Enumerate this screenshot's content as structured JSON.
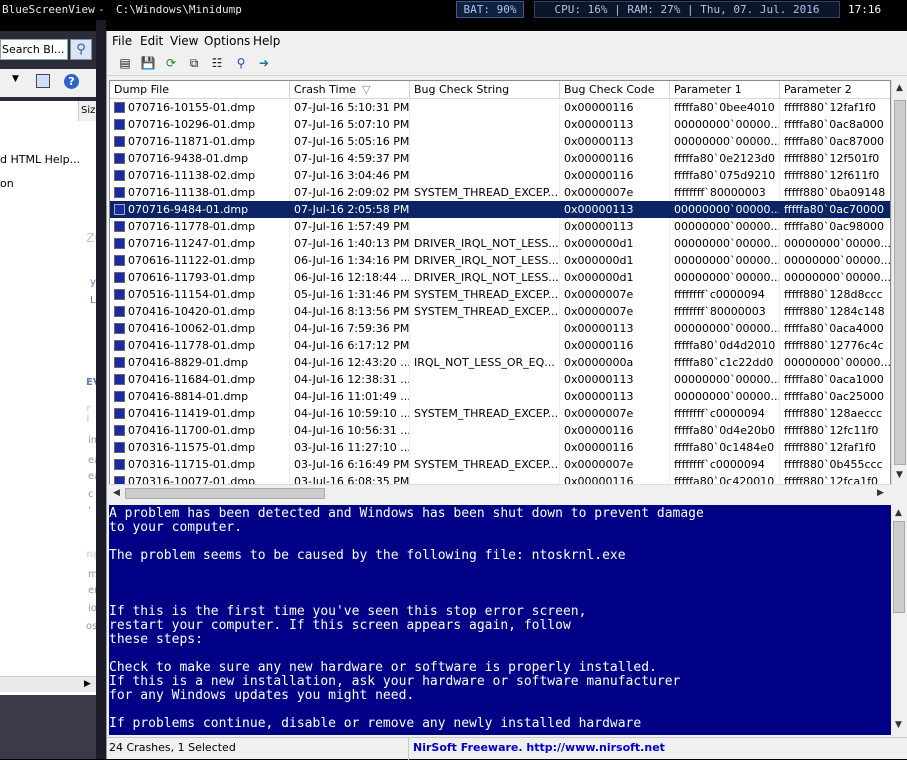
{
  "topbar": {
    "app_title": "BlueScreenView",
    "separator": "-",
    "path": "C:\\Windows\\Minidump",
    "battery": "BAT:  90%",
    "sysinfo": "CPU:  16% | RAM:  27% | Thu, 07. Jul. 2016",
    "clock": "17:16"
  },
  "background_window": {
    "search_placeholder": "Search Bl...",
    "items": [
      "d HTML Help...",
      "on"
    ],
    "size_header": "Siz",
    "fragments": [
      "ze",
      "yo",
      "L",
      "EV",
      "r l",
      "im",
      "ea",
      "ea",
      "c ,",
      "ng",
      "mu",
      "ers",
      "io",
      "ostic"
    ]
  },
  "menu": {
    "file": "File",
    "edit": "Edit",
    "view": "View",
    "options": "Options",
    "help": "Help"
  },
  "toolbar_icons": [
    "properties-icon",
    "save-icon",
    "refresh-icon",
    "copy-icon",
    "report-icon",
    "find-icon",
    "exit-icon"
  ],
  "columns": {
    "dump_file": "Dump File",
    "crash_time": "Crash Time",
    "sort_indicator": "▽",
    "bug_check_string": "Bug Check String",
    "bug_check_code": "Bug Check Code",
    "parameter1": "Parameter 1",
    "parameter2": "Parameter 2"
  },
  "rows": [
    {
      "file": "070716-10155-01.dmp",
      "time": "07-Jul-16 5:10:31 PM",
      "bcs": "",
      "code": "0x00000116",
      "p1": "fffffa80`0bee4010",
      "p2": "fffff880`12faf1f0"
    },
    {
      "file": "070716-10296-01.dmp",
      "time": "07-Jul-16 5:07:10 PM",
      "bcs": "",
      "code": "0x00000113",
      "p1": "00000000`00000...",
      "p2": "fffffa80`0ac8a000"
    },
    {
      "file": "070716-11871-01.dmp",
      "time": "07-Jul-16 5:05:16 PM",
      "bcs": "",
      "code": "0x00000113",
      "p1": "00000000`00000...",
      "p2": "fffffa80`0ac87000"
    },
    {
      "file": "070716-9438-01.dmp",
      "time": "07-Jul-16 4:59:37 PM",
      "bcs": "",
      "code": "0x00000116",
      "p1": "fffffa80`0e2123d0",
      "p2": "fffff880`12f501f0"
    },
    {
      "file": "070716-11138-02.dmp",
      "time": "07-Jul-16 3:04:46 PM",
      "bcs": "",
      "code": "0x00000116",
      "p1": "fffffa80`075d9210",
      "p2": "fffff880`12f611f0"
    },
    {
      "file": "070716-11138-01.dmp",
      "time": "07-Jul-16 2:09:02 PM",
      "bcs": "SYSTEM_THREAD_EXCEP...",
      "code": "0x0000007e",
      "p1": "ffffffff`80000003",
      "p2": "fffff880`0ba09148"
    },
    {
      "file": "070716-9484-01.dmp",
      "time": "07-Jul-16 2:05:58 PM",
      "bcs": "",
      "code": "0x00000113",
      "p1": "00000000`00000...",
      "p2": "fffffa80`0ac70000",
      "selected": true
    },
    {
      "file": "070716-11778-01.dmp",
      "time": "07-Jul-16 1:57:49 PM",
      "bcs": "",
      "code": "0x00000113",
      "p1": "00000000`00000...",
      "p2": "fffffa80`0ac98000"
    },
    {
      "file": "070716-11247-01.dmp",
      "time": "07-Jul-16 1:40:13 PM",
      "bcs": "DRIVER_IRQL_NOT_LESS...",
      "code": "0x000000d1",
      "p1": "00000000`00000...",
      "p2": "00000000`00000..."
    },
    {
      "file": "070616-11122-01.dmp",
      "time": "06-Jul-16 1:34:16 PM",
      "bcs": "DRIVER_IRQL_NOT_LESS...",
      "code": "0x000000d1",
      "p1": "00000000`00000...",
      "p2": "00000000`00000..."
    },
    {
      "file": "070616-11793-01.dmp",
      "time": "06-Jul-16 12:18:44 ...",
      "bcs": "DRIVER_IRQL_NOT_LESS...",
      "code": "0x000000d1",
      "p1": "00000000`00000...",
      "p2": "00000000`00000..."
    },
    {
      "file": "070516-11154-01.dmp",
      "time": "05-Jul-16 1:31:46 PM",
      "bcs": "SYSTEM_THREAD_EXCEP...",
      "code": "0x0000007e",
      "p1": "ffffffff`c0000094",
      "p2": "fffff880`128d8ccc"
    },
    {
      "file": "070416-10420-01.dmp",
      "time": "04-Jul-16 8:13:56 PM",
      "bcs": "SYSTEM_THREAD_EXCEP...",
      "code": "0x0000007e",
      "p1": "ffffffff`80000003",
      "p2": "fffff880`1284c148"
    },
    {
      "file": "070416-10062-01.dmp",
      "time": "04-Jul-16 7:59:36 PM",
      "bcs": "",
      "code": "0x00000113",
      "p1": "00000000`00000...",
      "p2": "fffffa80`0aca4000"
    },
    {
      "file": "070416-11778-01.dmp",
      "time": "04-Jul-16 6:17:12 PM",
      "bcs": "",
      "code": "0x00000116",
      "p1": "fffffa80`0d4d2010",
      "p2": "fffff880`12776c4c"
    },
    {
      "file": "070416-8829-01.dmp",
      "time": "04-Jul-16 12:43:20 ...",
      "bcs": "IRQL_NOT_LESS_OR_EQ...",
      "code": "0x0000000a",
      "p1": "fffffa80`c1c22dd0",
      "p2": "00000000`00000..."
    },
    {
      "file": "070416-11684-01.dmp",
      "time": "04-Jul-16 12:38:31 ...",
      "bcs": "",
      "code": "0x00000113",
      "p1": "00000000`00000...",
      "p2": "fffffa80`0aca1000"
    },
    {
      "file": "070416-8814-01.dmp",
      "time": "04-Jul-16 11:01:49 ...",
      "bcs": "",
      "code": "0x00000113",
      "p1": "00000000`00000...",
      "p2": "fffffa80`0ac25000"
    },
    {
      "file": "070416-11419-01.dmp",
      "time": "04-Jul-16 10:59:10 ...",
      "bcs": "SYSTEM_THREAD_EXCEP...",
      "code": "0x0000007e",
      "p1": "ffffffff`c0000094",
      "p2": "fffff880`128aeccc"
    },
    {
      "file": "070416-11700-01.dmp",
      "time": "04-Jul-16 10:56:31 ...",
      "bcs": "",
      "code": "0x00000116",
      "p1": "fffffa80`0d4e20b0",
      "p2": "fffff880`12fc11f0"
    },
    {
      "file": "070316-11575-01.dmp",
      "time": "03-Jul-16 11:27:10 ...",
      "bcs": "",
      "code": "0x00000116",
      "p1": "fffffa80`0c1484e0",
      "p2": "fffff880`12faf1f0"
    },
    {
      "file": "070316-11715-01.dmp",
      "time": "03-Jul-16 6:16:49 PM",
      "bcs": "SYSTEM_THREAD_EXCEP...",
      "code": "0x0000007e",
      "p1": "ffffffff`c0000094",
      "p2": "fffff880`0b455ccc"
    },
    {
      "file": "070316-10077-01.dmp",
      "time": "03-Jul-16 6:08:35 PM",
      "bcs": "",
      "code": "0x00000116",
      "p1": "fffffa80`0c420010",
      "p2": "fffff880`12fca1f0"
    }
  ],
  "bsod_text": "A problem has been detected and Windows has been shut down to prevent damage\nto your computer.\n\nThe problem seems to be caused by the following file: ntoskrnl.exe\n\n\n\nIf this is the first time you've seen this stop error screen,\nrestart your computer. If this screen appears again, follow\nthese steps:\n\nCheck to make sure any new hardware or software is properly installed.\nIf this is a new installation, ask your hardware or software manufacturer\nfor any Windows updates you might need.\n\nIf problems continue, disable or remove any newly installed hardware",
  "status": {
    "crashes": "24 Crashes, 1 Selected",
    "credit": "NirSoft Freeware.  http://www.nirsoft.net"
  },
  "colors": {
    "bsod_bg": "#000087",
    "selection": "#0a2466",
    "credit_link": "#0000cc"
  }
}
